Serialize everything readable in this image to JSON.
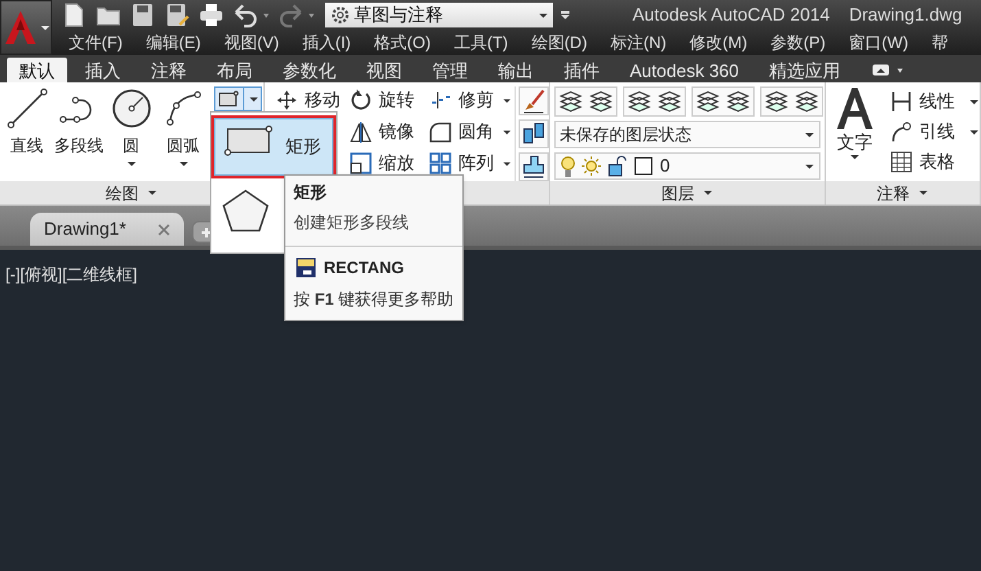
{
  "workspace": "草图与注释",
  "title": "Autodesk AutoCAD 2014",
  "file_name": "Drawing1.dwg",
  "menus": [
    "文件(F)",
    "编辑(E)",
    "视图(V)",
    "插入(I)",
    "格式(O)",
    "工具(T)",
    "绘图(D)",
    "标注(N)",
    "修改(M)",
    "参数(P)",
    "窗口(W)",
    "帮"
  ],
  "ribbon_tabs": [
    {
      "label": "默认",
      "selected": true
    },
    {
      "label": "插入",
      "selected": false
    },
    {
      "label": "注释",
      "selected": false
    },
    {
      "label": "布局",
      "selected": false
    },
    {
      "label": "参数化",
      "selected": false
    },
    {
      "label": "视图",
      "selected": false
    },
    {
      "label": "管理",
      "selected": false
    },
    {
      "label": "输出",
      "selected": false
    },
    {
      "label": "插件",
      "selected": false
    },
    {
      "label": "Autodesk 360",
      "selected": false
    },
    {
      "label": "精选应用",
      "selected": false
    }
  ],
  "draw_panel": {
    "title": "绘图",
    "tools": [
      {
        "label": "直线",
        "kind": "line",
        "has_menu": false
      },
      {
        "label": "多段线",
        "kind": "polyline",
        "has_menu": false
      },
      {
        "label": "圆",
        "kind": "circle",
        "has_menu": true
      },
      {
        "label": "圆弧",
        "kind": "arc",
        "has_menu": true
      }
    ]
  },
  "modify_panel": {
    "columns": [
      [
        {
          "label": "移动",
          "kind": "move",
          "has_menu": false
        }
      ],
      [
        {
          "label": "旋转",
          "kind": "rotate",
          "has_menu": false
        },
        {
          "label": "镜像",
          "kind": "mirror",
          "has_menu": false
        },
        {
          "label": "缩放",
          "kind": "scale",
          "has_menu": false
        }
      ],
      [
        {
          "label": "修剪",
          "kind": "trim",
          "has_menu": true
        },
        {
          "label": "圆角",
          "kind": "fillet",
          "has_menu": true
        },
        {
          "label": "阵列",
          "kind": "array",
          "has_menu": true
        }
      ]
    ]
  },
  "layers_panel": {
    "title": "图层",
    "layer_state": "未保存的图层状态",
    "current_layer": "0"
  },
  "annotation_panel": {
    "title": "注释",
    "big_tool": "文字",
    "tools": [
      {
        "label": "线性",
        "kind": "linear",
        "has_menu": true
      },
      {
        "label": "引线",
        "kind": "leader",
        "has_menu": true
      },
      {
        "label": "表格",
        "kind": "table",
        "has_menu": false
      }
    ]
  },
  "document_tabs": [
    {
      "label": "Drawing1*",
      "selected": true
    }
  ],
  "viewport_label": "[-][俯视][二维线框]",
  "dropdown": [
    {
      "label": "矩形",
      "kind": "rectangle",
      "selected": true
    },
    {
      "kind": "polygon",
      "selected": false
    }
  ],
  "tooltip": {
    "title": "矩形",
    "description": "创建矩形多段线",
    "command": "RECTANG",
    "help": "按 **F1** 键获得更多帮助"
  }
}
